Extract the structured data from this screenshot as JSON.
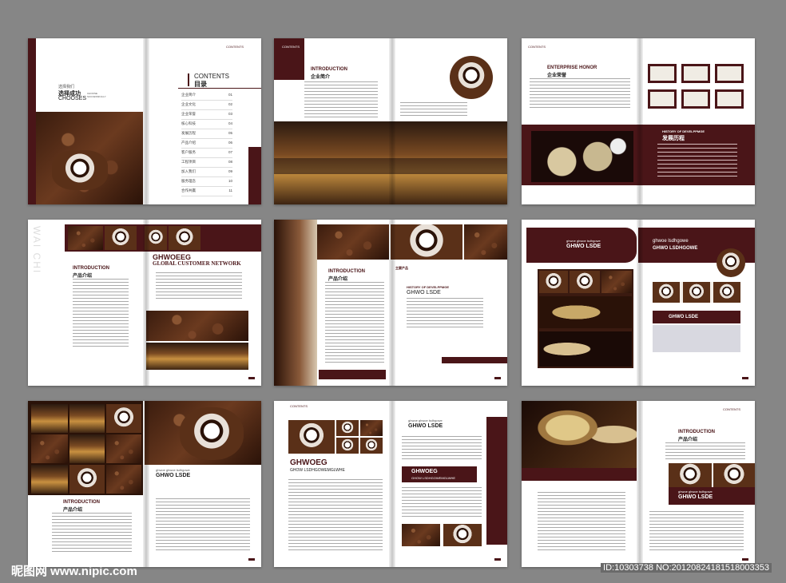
{
  "spread1": {
    "corner": "CONTENTS",
    "tagline": "选择我们",
    "choose_cn": "选择成功",
    "choose_en": "CHOOSES",
    "choose_small": "CHOOSE SUCCESSFULLY",
    "contents_title": "CONTENTS",
    "contents_cn": "目录",
    "toc": [
      {
        "label": "企业简介",
        "page": "01"
      },
      {
        "label": "企业文化",
        "page": "02"
      },
      {
        "label": "企业荣誉",
        "page": "03"
      },
      {
        "label": "核心科技",
        "page": "04"
      },
      {
        "label": "发展历程",
        "page": "05"
      },
      {
        "label": "产品介绍",
        "page": "06"
      },
      {
        "label": "客户服务",
        "page": "07"
      },
      {
        "label": "工程项目",
        "page": "08"
      },
      {
        "label": "加入我们",
        "page": "09"
      },
      {
        "label": "服务理念",
        "page": "10"
      },
      {
        "label": "合作共赢",
        "page": "11"
      }
    ]
  },
  "spread2": {
    "corner": "CONTENTS",
    "title_en": "INTRODUCTION",
    "title_cn": "企业简介"
  },
  "spread3": {
    "corner": "CONTENTS",
    "title_en": "ENTERPRISE HONOR",
    "title_cn": "企业荣誉",
    "history_en": "HISTORY OF DEVELPPMGE",
    "history_cn": "发展历程"
  },
  "spread4": {
    "vertical": "WAI CHI",
    "title_en": "INTRODUCTION",
    "title_cn": "产品介绍",
    "network_1": "GHWOEEG",
    "network_2": "GLOBAL CUSTOMER NETWORK"
  },
  "spread5": {
    "title_en": "INTRODUCTION",
    "title_cn": "产品介绍",
    "product_cn": "主要产品",
    "history_en": "HISTORY OF DEVELPPMGE",
    "ghwo": "GHWO LSDE"
  },
  "spread6": {
    "small_1": "ghwoe ghwoe lsdhgowe",
    "ghwo": "GHWO LSDE",
    "small_2": "ghwoe lsdhgowe",
    "ghwo_big": "GHWO LSDHGOWE",
    "ghwo_bottom": "GHWO LSDE"
  },
  "spread7": {
    "title_en": "INTRODUCTION",
    "title_cn": "产品介绍",
    "small": "ghwoe ghwoe lsdhgowe",
    "ghwo": "GHWO LSDE"
  },
  "spread8": {
    "corner": "CONTENTS",
    "ghwoeg": "GHWOEG",
    "sub": "GHOW LSDHGOWEMGLWHE",
    "small": "ghwoe ghwoe lsdhgowe",
    "ghwo": "GHWO LSDE",
    "box_title": "GHWOEG",
    "box_sub": "GHOW LSDHGOWEMGLWHE"
  },
  "spread9": {
    "corner": "CONTENTS",
    "title_en": "INTRODUCTION",
    "title_cn": "产品介绍",
    "small": "ghwoe ghwoe lsdhgowe",
    "ghwo": "GHWO LSDE"
  },
  "watermark": {
    "left": "昵图网 www.nipic.com",
    "right": "ID:10303738 NO:20120824181518003353"
  }
}
